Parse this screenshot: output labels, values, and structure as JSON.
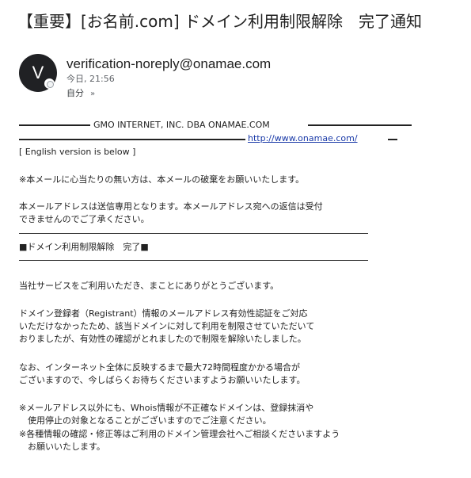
{
  "subject": "【重要】[お名前.com] ドメイン利用制限解除　完了通知",
  "sender": {
    "avatar_letter": "V",
    "email": "verification-noreply@onamae.com",
    "time": "今日, 21:56",
    "recipient": "自分",
    "chevron": "»"
  },
  "body": {
    "company_banner": "GMO INTERNET, INC. DBA ONAMAE.COM",
    "url": "http://www.onamae.com/",
    "english_note": "[ English version is below ]",
    "disclaimer": "※本メールに心当たりの無い方は、本メールの破棄をお願いいたします。",
    "send_only_1": "本メールアドレスは送信専用となります。本メールアドレス宛への返信は受付",
    "send_only_2": "できませんのでご了承ください。",
    "section_title": "■ドメイン利用制限解除　完了■",
    "greeting": "当社サービスをご利用いただき、まことにありがとうございます。",
    "p1_1": "ドメイン登録者（Registrant）情報のメールアドレス有効性認証をご対応",
    "p1_2": "いただけなかったため、該当ドメインに対して利用を制限させていただいて",
    "p1_3": "おりましたが、有効性の確認がとれましたので制限を解除いたしました。",
    "p2_1": "なお、インターネット全体に反映するまで最大72時間程度かかる場合が",
    "p2_2": "ございますので、今しばらくお待ちくださいますようお願いいたします。",
    "n1_1": "※メールアドレス以外にも、Whois情報が不正確なドメインは、登録抹消や",
    "n1_2": "　使用停止の対象となることがございますのでご注意ください。",
    "n2_1": "※各種情報の確認・修正等はご利用のドメイン管理会社へご相談くださいますよう",
    "n2_2": "　お願いいたします。"
  }
}
